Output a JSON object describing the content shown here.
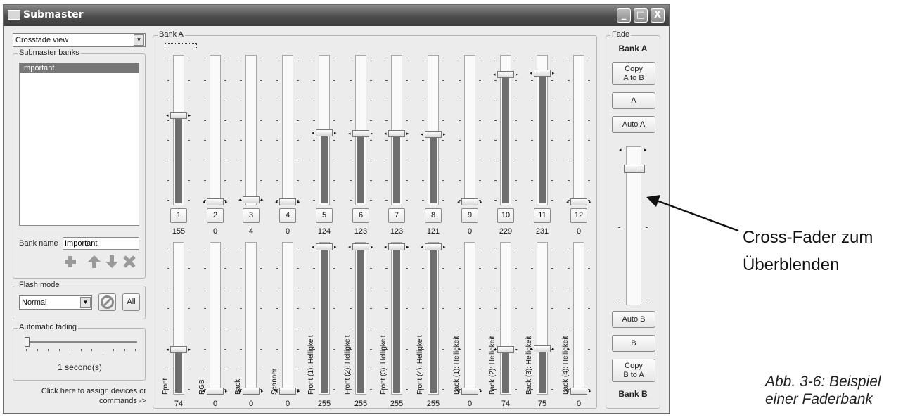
{
  "window": {
    "title": "Submaster",
    "buttons": {
      "minimize": "_",
      "maximize": "□",
      "close": "X"
    }
  },
  "left": {
    "view_select": "Crossfade view",
    "banks_group": "Submaster banks",
    "banks": [
      "Important"
    ],
    "bank_name_label": "Bank name",
    "bank_name_value": "Important",
    "bank_tools": [
      "add-icon",
      "arrow-up-icon",
      "arrow-down-icon",
      "delete-icon"
    ],
    "flash_group": "Flash mode",
    "flash_mode": "Normal",
    "flash_all": "All",
    "auto_group": "Automatic fading",
    "auto_fade_value": "1 second(s)",
    "auto_fade_level": 0,
    "assign_line1": "Click here to assign devices or",
    "assign_line2": "commands ->"
  },
  "bank": {
    "title": "Bank A",
    "top_faders": [
      {
        "num": "1",
        "value": "155"
      },
      {
        "num": "2",
        "value": "0"
      },
      {
        "num": "3",
        "value": "4"
      },
      {
        "num": "4",
        "value": "0"
      },
      {
        "num": "5",
        "value": "124"
      },
      {
        "num": "6",
        "value": "123"
      },
      {
        "num": "7",
        "value": "123"
      },
      {
        "num": "8",
        "value": "121"
      },
      {
        "num": "9",
        "value": "0"
      },
      {
        "num": "10",
        "value": "229"
      },
      {
        "num": "11",
        "value": "231"
      },
      {
        "num": "12",
        "value": "0"
      }
    ],
    "bottom_faders": [
      {
        "label": "Front",
        "value": "74"
      },
      {
        "label": "RGB",
        "value": "0"
      },
      {
        "label": "Back",
        "value": "0"
      },
      {
        "label": "Scanner",
        "value": "0"
      },
      {
        "label": "Front (1): Helligkeit",
        "value": "255"
      },
      {
        "label": "Front (2): Helligkeit",
        "value": "255"
      },
      {
        "label": "Front (3): Helligkeit",
        "value": "255"
      },
      {
        "label": "Front (4): Helligkeit",
        "value": "255"
      },
      {
        "label": "Back (1): Helligkeit",
        "value": "0"
      },
      {
        "label": "Back (2): Helligkeit",
        "value": "74"
      },
      {
        "label": "Back (3): Helligkeit",
        "value": "75"
      },
      {
        "label": "Back (4): Helligkeit",
        "value": "0"
      }
    ],
    "max_value": 255
  },
  "fade": {
    "group": "Fade",
    "bank_a": "Bank A",
    "copy_a_to_b_1": "Copy",
    "copy_a_to_b_2": "A to B",
    "a": "A",
    "auto_a": "Auto A",
    "crossfader_level": 0.04,
    "auto_b": "Auto B",
    "b": "B",
    "copy_b_to_a_1": "Copy",
    "copy_b_to_a_2": "B to A",
    "bank_b": "Bank B"
  },
  "annotation": {
    "line1": "Cross-Fader zum",
    "line2": "Überblenden"
  },
  "caption": {
    "line1": "Abb. 3-6: Beispiel",
    "line2": "einer Faderbank"
  },
  "colors": {
    "fill": "#6e6e6e",
    "titlebar": "#4d4d4d",
    "window_bg": "#ececec"
  }
}
